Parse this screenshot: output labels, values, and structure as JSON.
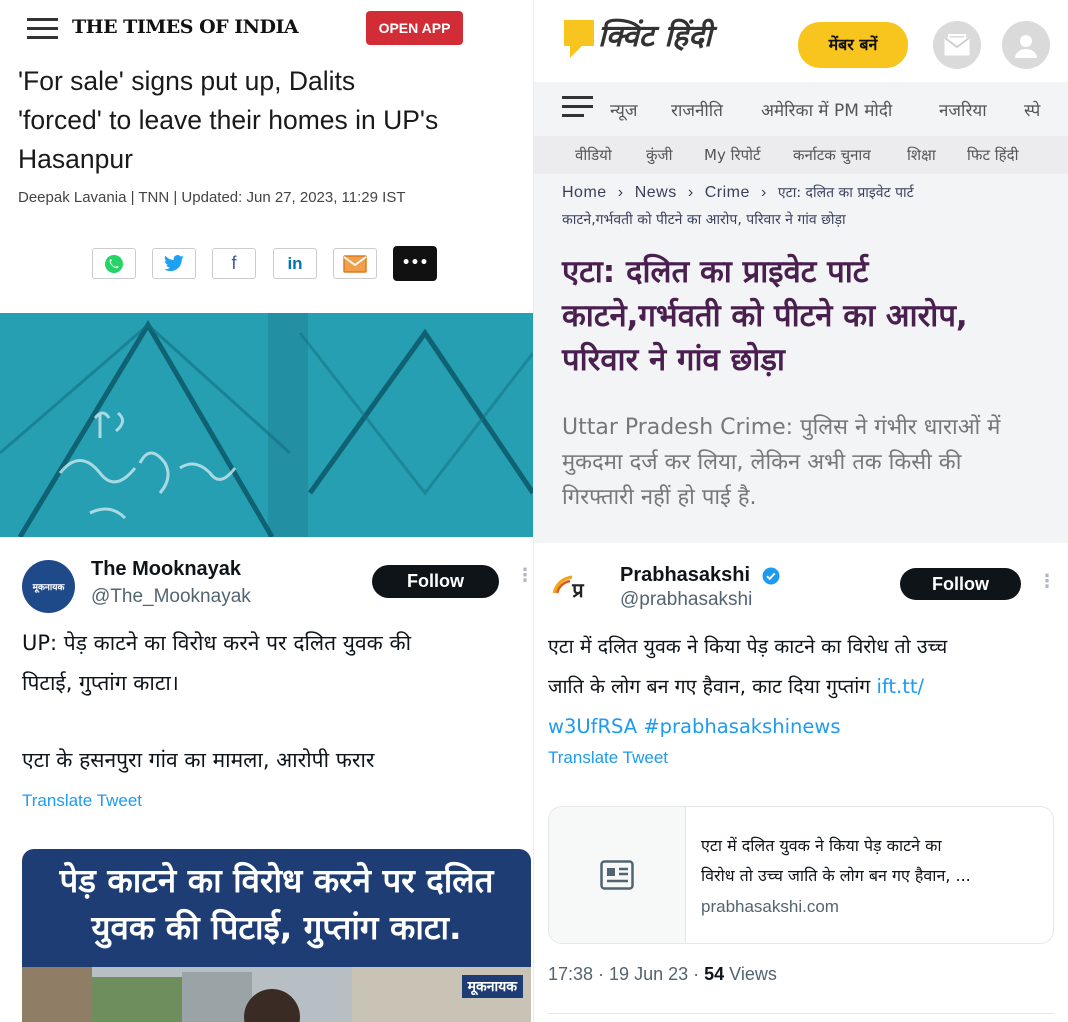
{
  "toi": {
    "brand": "THE TIMES OF INDIA",
    "open_app": "OPEN APP",
    "headline_lines": [
      "'For sale' signs put up, Dalits",
      "'forced' to leave their homes in UP's",
      "Hasanpur"
    ],
    "byline": "Deepak Lavania | TNN | Updated: Jun 27, 2023, 11:29 IST",
    "share_icons": [
      "whatsapp-icon",
      "twitter-icon",
      "facebook-icon",
      "linkedin-icon",
      "email-icon",
      "more-icon"
    ],
    "facebook_glyph": "f",
    "linkedin_glyph": "in",
    "more_glyph": "•••",
    "colors": {
      "open_app": "#d22d36",
      "photo_wall": "#2ba5b8"
    }
  },
  "quint": {
    "logo_text": "क्विंट हिंदी",
    "member_button": "मेंबर बनें",
    "nav_primary": [
      "न्यूज",
      "राजनीति",
      "अमेरिका में PM मोदी",
      "नजरिया",
      "स्पे"
    ],
    "nav_secondary": [
      "वीडियो",
      "कुंजी",
      "My रिपोर्ट",
      "कर्नाटक चुनाव",
      "शिक्षा",
      "फिट हिंदी"
    ],
    "breadcrumb": {
      "home": "Home",
      "news": "News",
      "crime": "Crime",
      "sep": "›",
      "current_line1": "एटा: दलित का प्राइवेट पार्ट",
      "current_line2": "काटने,गर्भवती को पीटने का आरोप, परिवार ने गांव छोड़ा"
    },
    "headline_lines": [
      "एटा: दलित का प्राइवेट पार्ट",
      "काटने,गर्भवती को पीटने का आरोप,",
      "परिवार ने गांव छोड़ा"
    ],
    "subhead_lines": [
      "Uttar Pradesh Crime: पुलिस ने गंभीर धाराओं में",
      "मुकदमा दर्ज कर लिया, लेकिन अभी तक किसी की",
      "गिरफ्तारी नहीं हो पाई है."
    ],
    "colors": {
      "logo": "#f7c51e",
      "headline": "#4a1f4f"
    }
  },
  "mooknayak": {
    "name": "The Mooknayak",
    "handle": "@The_Mooknayak",
    "avatar_text": "मूकनायक",
    "follow": "Follow",
    "text_lines": [
      "UP: पेड़ काटने का विरोध करने पर दलित युवक की",
      "पिटाई, गुप्तांग काटा।"
    ],
    "text_line3": "एटा के हसनपुरा गांव का मामला, आरोपी फरार",
    "translate": "Translate Tweet",
    "image_caption_lines": [
      "पेड़ काटने का विरोध करने पर दलित",
      "युवक की पिटाई, गुप्तांग काटा."
    ],
    "image_watermark": "मूकनायक"
  },
  "prabhasakshi": {
    "name": "Prabhasakshi",
    "handle": "@prabhasakshi",
    "avatar_text": "प्र",
    "verified": "verified-badge-icon",
    "follow": "Follow",
    "text_line1": "एटा में दलित युवक ने किया पेड़ काटने का विरोध तो उच्च",
    "text_line2_plain": "जाति के लोग बन गए हैवान, काट दिया गुप्तांग ",
    "text_line2_link": "ift.tt/",
    "text_line3": "w3UfRSA #prabhasakshinews",
    "translate": "Translate Tweet",
    "card": {
      "line1": "एटा में दलित युवक ने किया पेड़ काटने का",
      "line2": "विरोध तो उच्च जाति के लोग बन गए हैवान, ...",
      "domain": "prabhasakshi.com"
    },
    "time": "17:38 · 19 Jun 23 · ",
    "views_count": "54",
    "views_label": " Views"
  }
}
